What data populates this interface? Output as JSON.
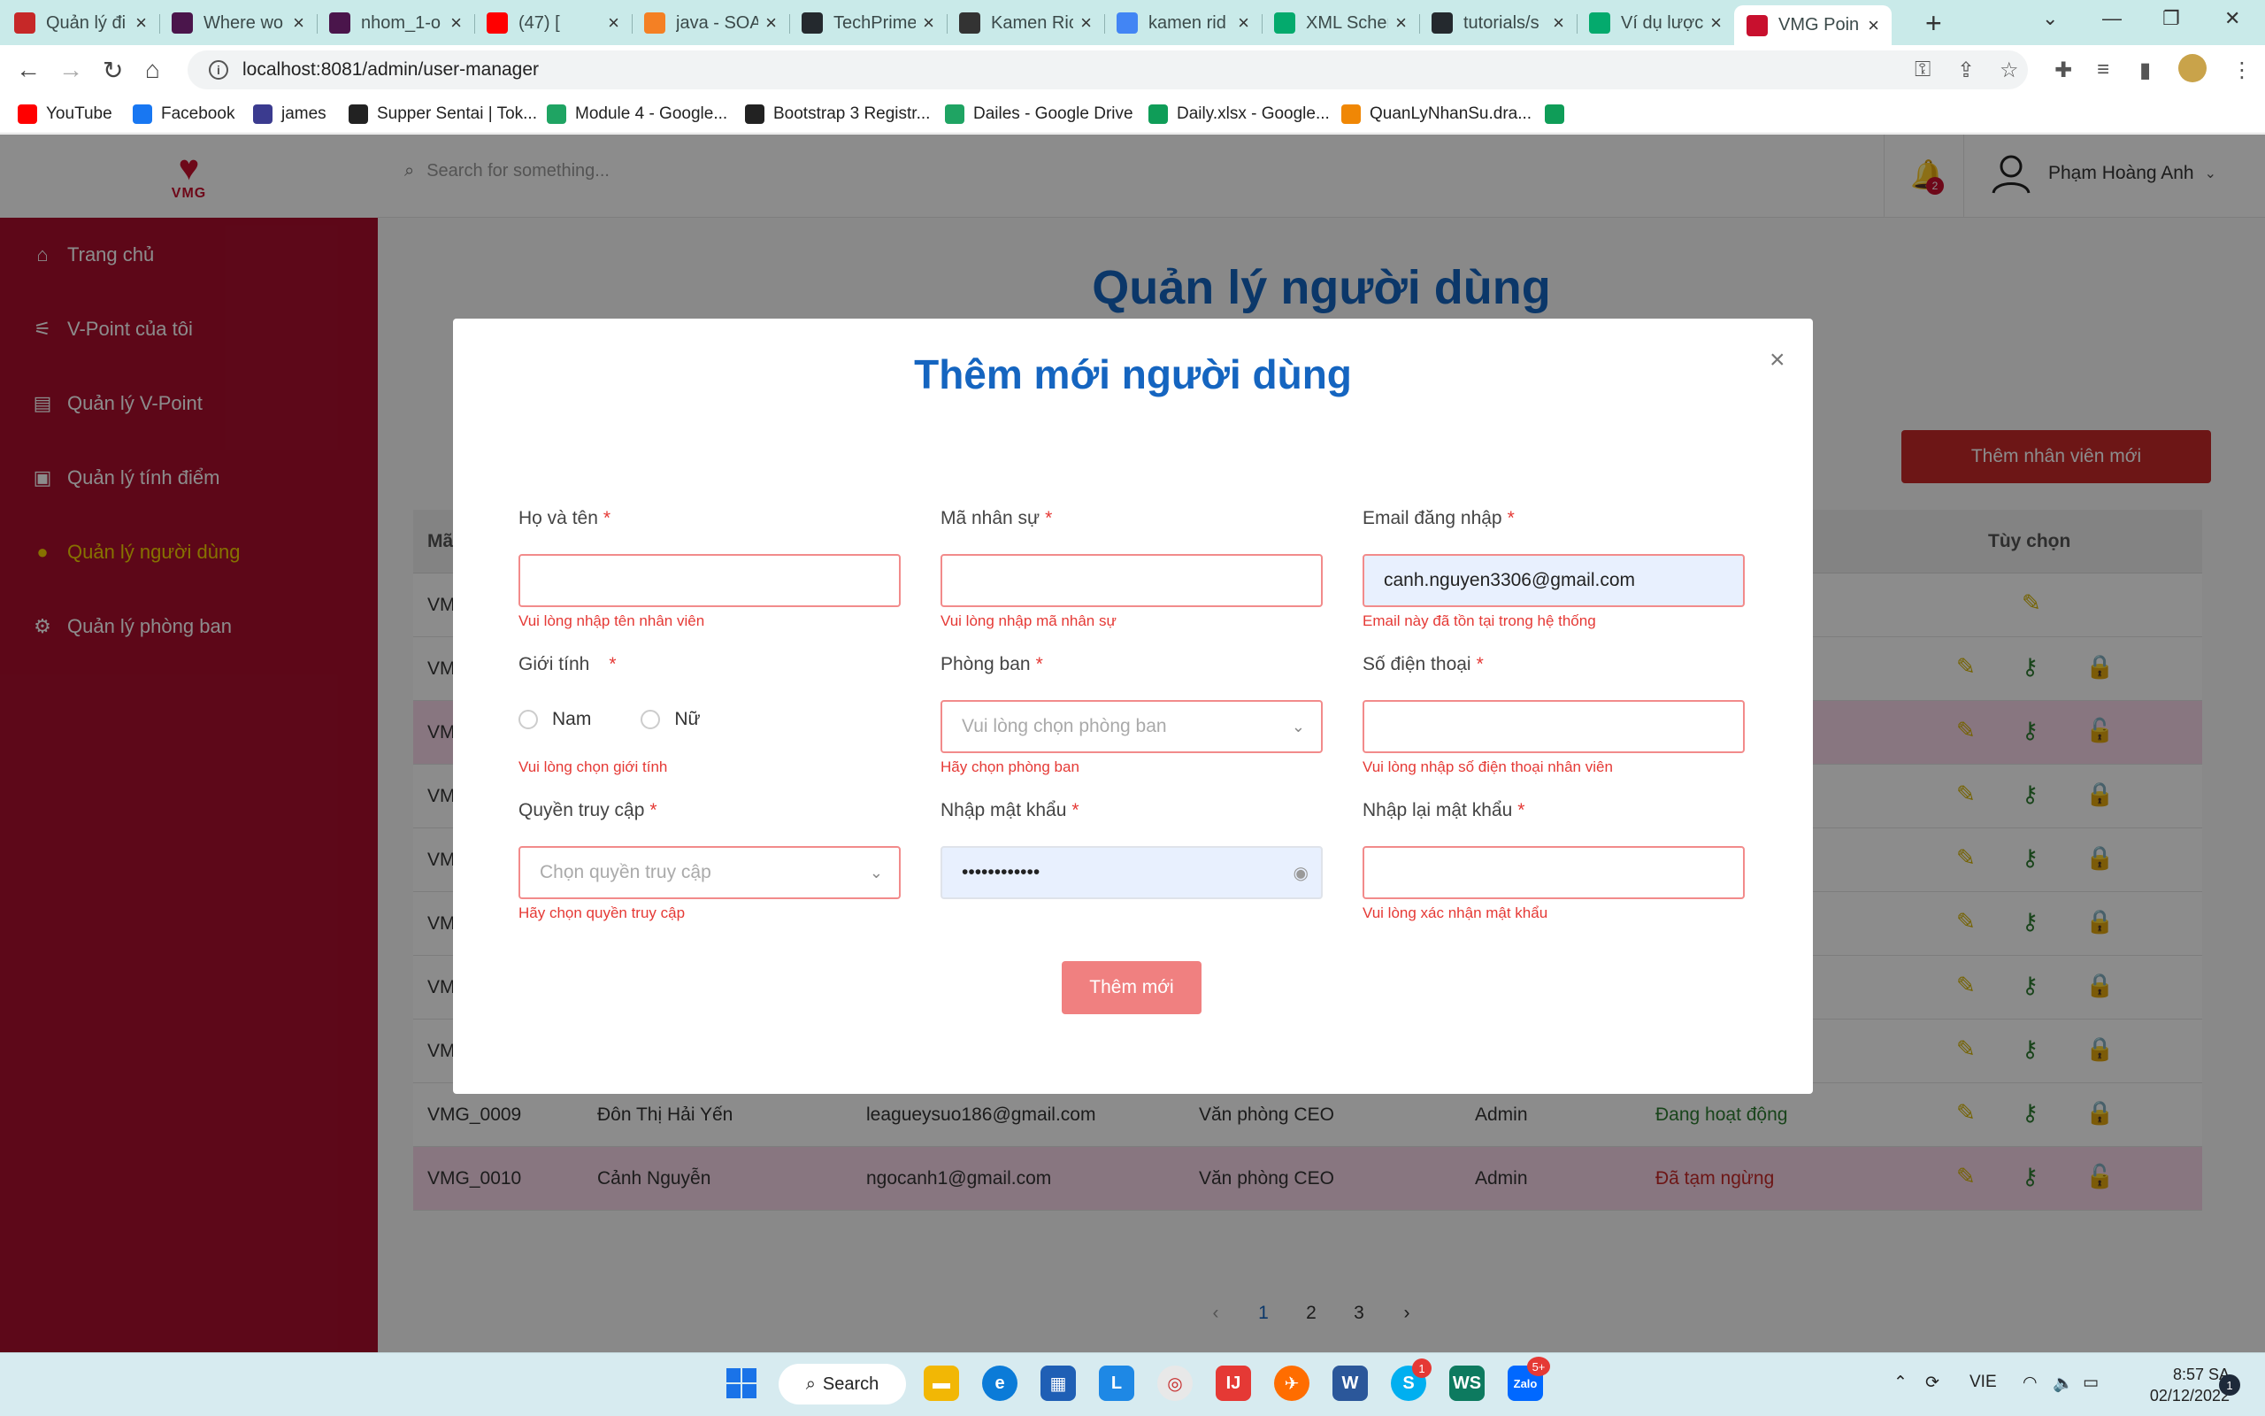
{
  "browser": {
    "tabs": [
      {
        "label": "Quản lý đi",
        "icon": "document-icon",
        "color": "#c62828"
      },
      {
        "label": "Where wo",
        "icon": "slack-icon",
        "color": "#4a154b"
      },
      {
        "label": "nhom_1-o",
        "icon": "slack-icon",
        "color": "#4a154b"
      },
      {
        "label": "(47) [",
        "icon": "youtube-icon",
        "color": "#ff0000"
      },
      {
        "label": "java - SOA",
        "icon": "stackoverflow-icon",
        "color": "#f48024"
      },
      {
        "label": "TechPrime",
        "icon": "github-icon",
        "color": "#24292e"
      },
      {
        "label": "Kamen Ric",
        "icon": "globe-icon",
        "color": "#333333"
      },
      {
        "label": "kamen rid",
        "icon": "google-icon",
        "color": "#4285f4"
      },
      {
        "label": "XML Scher",
        "icon": "w3schools-icon",
        "color": "#04aa6d"
      },
      {
        "label": "tutorials/s",
        "icon": "github-icon",
        "color": "#24292e"
      },
      {
        "label": "Ví dụ lược",
        "icon": "w3schools-icon",
        "color": "#04aa6d"
      },
      {
        "label": "VMG Poin",
        "icon": "vmg-icon",
        "color": "#c8102e",
        "active": true
      }
    ],
    "url": "localhost:8081/admin/user-manager",
    "bookmarks": [
      {
        "label": "YouTube",
        "icon": "youtube-icon",
        "color": "#ff0000"
      },
      {
        "label": "Facebook",
        "icon": "facebook-icon",
        "color": "#1877f2"
      },
      {
        "label": "james",
        "icon": "bookmark-icon",
        "color": "#3b3b8f"
      },
      {
        "label": "Supper Sentai | Tok...",
        "icon": "globe-icon",
        "color": "#222222"
      },
      {
        "label": "Module 4 - Google...",
        "icon": "drive-icon",
        "color": "#1fa463"
      },
      {
        "label": "Bootstrap 3 Registr...",
        "icon": "codepen-icon",
        "color": "#222222"
      },
      {
        "label": "Dailes - Google Drive",
        "icon": "drive-icon",
        "color": "#1fa463"
      },
      {
        "label": "Daily.xlsx - Google...",
        "icon": "sheets-icon",
        "color": "#0f9d58"
      },
      {
        "label": "QuanLyNhanSu.dra...",
        "icon": "drawio-icon",
        "color": "#f08705"
      },
      {
        "label": "",
        "icon": "sheets-icon",
        "color": "#0f9d58"
      }
    ]
  },
  "app": {
    "logo_text": "VMG",
    "search_placeholder": "Search for something...",
    "notification_count": "2",
    "user_name": "Phạm Hoàng Anh",
    "sidebar": [
      {
        "label": "Trang chủ",
        "icon": "home-icon"
      },
      {
        "label": "V-Point của tôi",
        "icon": "chart-icon"
      },
      {
        "label": "Quản lý V-Point",
        "icon": "document-icon"
      },
      {
        "label": "Quản lý tính điểm",
        "icon": "wallet-icon"
      },
      {
        "label": "Quản lý người dùng",
        "icon": "user-icon",
        "active": true
      },
      {
        "label": "Quản lý phòng ban",
        "icon": "department-icon"
      }
    ],
    "page_title": "Quản lý người dùng",
    "add_employee_label": "Thêm nhân viên mới",
    "table": {
      "col_first": "Mã",
      "col_options": "Tùy chọn",
      "rows": [
        {
          "code": "VM",
          "name": "",
          "email": "",
          "dept": "",
          "role": "",
          "status": "",
          "status_type": "",
          "alt": false,
          "actions": [
            "edit"
          ]
        },
        {
          "code": "VM",
          "name": "",
          "email": "",
          "dept": "",
          "role": "",
          "status": "",
          "status_type": "",
          "alt": false,
          "actions": [
            "edit",
            "key",
            "lock"
          ]
        },
        {
          "code": "VM",
          "name": "",
          "email": "",
          "dept": "",
          "role": "",
          "status": "",
          "status_type": "",
          "alt": true,
          "actions": [
            "edit",
            "key",
            "unlock"
          ]
        },
        {
          "code": "VM",
          "name": "",
          "email": "",
          "dept": "",
          "role": "",
          "status": "",
          "status_type": "",
          "alt": false,
          "actions": [
            "edit",
            "key",
            "lock"
          ]
        },
        {
          "code": "VM",
          "name": "",
          "email": "",
          "dept": "",
          "role": "",
          "status": "",
          "status_type": "",
          "alt": false,
          "actions": [
            "edit",
            "key",
            "lock"
          ]
        },
        {
          "code": "VM",
          "name": "",
          "email": "",
          "dept": "",
          "role": "",
          "status": "",
          "status_type": "",
          "alt": false,
          "actions": [
            "edit",
            "key",
            "lock"
          ]
        },
        {
          "code": "VM",
          "name": "",
          "email": "",
          "dept": "",
          "role": "",
          "status": "",
          "status_type": "",
          "alt": false,
          "actions": [
            "edit",
            "key",
            "lock"
          ]
        },
        {
          "code": "VM",
          "name": "",
          "email": "",
          "dept": "",
          "role": "",
          "status": "",
          "status_type": "",
          "alt": false,
          "actions": [
            "edit",
            "key",
            "lock"
          ]
        },
        {
          "code": "VMG_0009",
          "name": "Đôn Thị Hải Yến",
          "email": "leagueysuo186@gmail.com",
          "dept": "Văn phòng CEO",
          "role": "Admin",
          "status": "Đang hoạt động",
          "status_type": "active",
          "alt": false,
          "actions": [
            "edit",
            "key",
            "lock"
          ]
        },
        {
          "code": "VMG_0010",
          "name": "Cảnh Nguyễn",
          "email": "ngocanh1@gmail.com",
          "dept": "Văn phòng CEO",
          "role": "Admin",
          "status": "Đã tạm ngừng",
          "status_type": "suspended",
          "alt": true,
          "actions": [
            "edit",
            "key",
            "unlock"
          ]
        }
      ]
    },
    "pagination": {
      "prev": "‹",
      "pages": [
        "1",
        "2",
        "3"
      ],
      "current": "1",
      "next": "›"
    }
  },
  "modal": {
    "title": "Thêm mới người dùng",
    "close": "×",
    "required_mark": "*",
    "fields": {
      "fullname": {
        "label": "Họ và tên",
        "value": "",
        "error": "Vui lòng nhập tên nhân viên"
      },
      "employee_code": {
        "label": "Mã nhân sự",
        "value": "",
        "error": "Vui lòng nhập mã nhân sự"
      },
      "email": {
        "label": "Email đăng nhập",
        "value": "canh.nguyen3306@gmail.com",
        "error": "Email này đã tồn tại trong hệ thống"
      },
      "gender": {
        "label": "Giới tính",
        "option_male": "Nam",
        "option_female": "Nữ",
        "error": "Vui lòng chọn giới tính"
      },
      "department": {
        "label": "Phòng ban",
        "placeholder": "Vui lòng chọn phòng ban",
        "error": "Hãy chọn phòng ban"
      },
      "phone": {
        "label": "Số điện thoại",
        "value": "",
        "error": "Vui lòng nhập số điện thoại nhân viên"
      },
      "role": {
        "label": "Quyền truy cập",
        "placeholder": "Chọn quyền truy cập",
        "error": "Hãy chọn quyền truy cập"
      },
      "password": {
        "label": "Nhập mật khẩu",
        "value": "••••••••••••"
      },
      "confirm_password": {
        "label": "Nhập lại mật khẩu",
        "value": "",
        "error": "Vui lòng xác nhận mật khẩu"
      }
    },
    "submit_label": "Thêm mới"
  },
  "taskbar": {
    "search_label": "Search",
    "language": "VIE",
    "time": "8:57 SA",
    "date": "02/12/2022",
    "notification_count": "1",
    "skype_badge": "1",
    "zalo_badge": "5+"
  }
}
